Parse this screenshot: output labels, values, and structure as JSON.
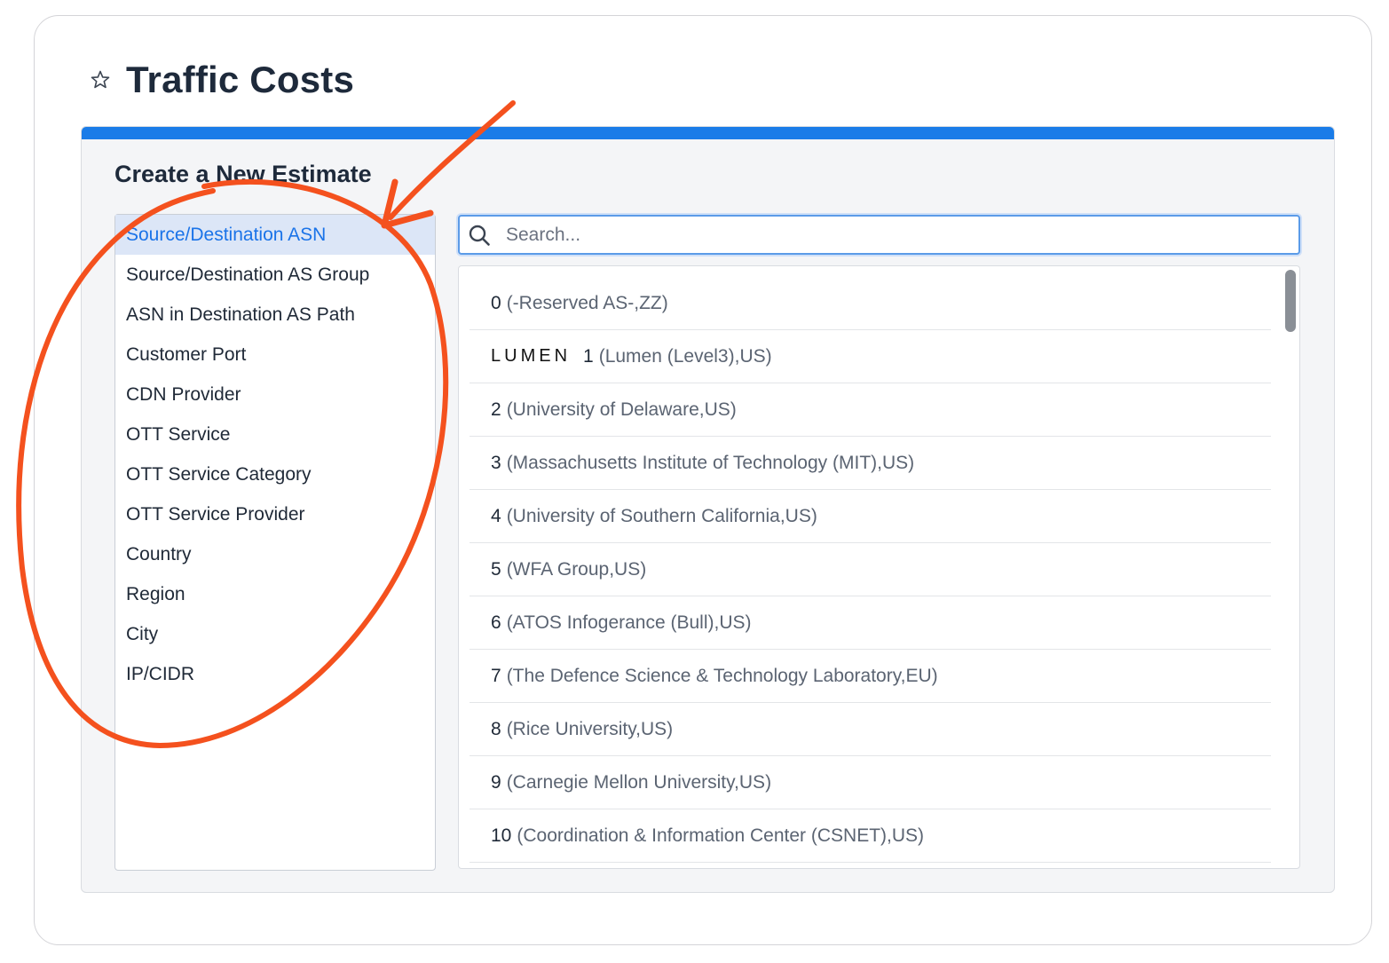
{
  "page": {
    "title": "Traffic Costs"
  },
  "panel": {
    "heading": "Create a New Estimate"
  },
  "dimensions": {
    "items": [
      {
        "label": "Source/Destination ASN",
        "active": true
      },
      {
        "label": "Source/Destination AS Group"
      },
      {
        "label": "ASN in Destination AS Path"
      },
      {
        "label": "Customer Port"
      },
      {
        "label": "CDN Provider"
      },
      {
        "label": "OTT Service"
      },
      {
        "label": "OTT Service Category"
      },
      {
        "label": "OTT Service Provider"
      },
      {
        "label": "Country"
      },
      {
        "label": "Region"
      },
      {
        "label": "City"
      },
      {
        "label": "IP/CIDR"
      }
    ]
  },
  "search": {
    "placeholder": "Search...",
    "value": ""
  },
  "results": {
    "rows": [
      {
        "num": "0",
        "name": "(-Reserved AS-,ZZ)"
      },
      {
        "num": "1",
        "name": "(Lumen (Level3),US)",
        "logo": "LUMEN"
      },
      {
        "num": "2",
        "name": "(University of Delaware,US)"
      },
      {
        "num": "3",
        "name": "(Massachusetts Institute of Technology (MIT),US)"
      },
      {
        "num": "4",
        "name": "(University of Southern California,US)"
      },
      {
        "num": "5",
        "name": "(WFA Group,US)"
      },
      {
        "num": "6",
        "name": "(ATOS Infogerance (Bull),US)"
      },
      {
        "num": "7",
        "name": "(The Defence Science & Technology Laboratory,EU)"
      },
      {
        "num": "8",
        "name": "(Rice University,US)"
      },
      {
        "num": "9",
        "name": "(Carnegie Mellon University,US)"
      },
      {
        "num": "10",
        "name": "(Coordination & Information Center (CSNET),US)"
      }
    ]
  },
  "colors": {
    "accent": "#1a7ce8",
    "annotation": "#f4511e",
    "active_bg": "#dce6f7"
  },
  "icons": {
    "favorite": "star-icon",
    "search": "search-icon"
  }
}
